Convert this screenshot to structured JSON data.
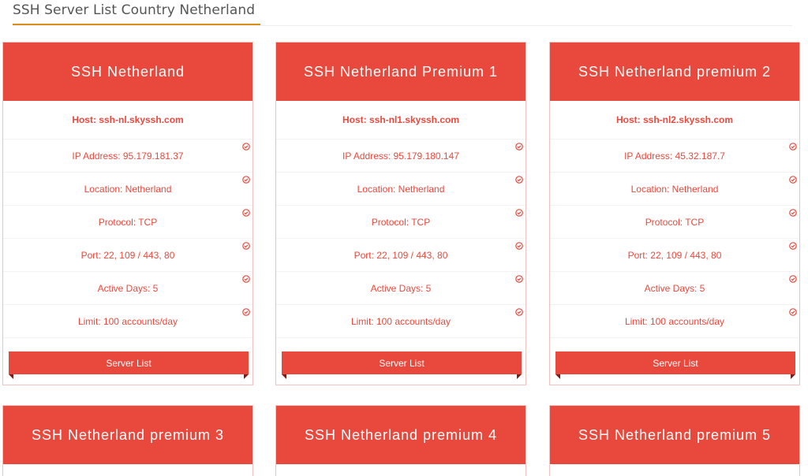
{
  "page": {
    "title": "SSH Server List Country Netherland"
  },
  "colors": {
    "accent": "#e8493c",
    "title_underline": "#d9901b",
    "card_border": "#f0c2c0"
  },
  "icons": {
    "row_status": "check-circle-icon"
  },
  "cards": [
    {
      "title": "SSH Netherland",
      "host": "Host: ssh-nl.skyssh.com",
      "ip": "IP Address: 95.179.181.37",
      "location": "Location: Netherland",
      "protocol": "Protocol: TCP",
      "port": "Port: 22, 109 / 443, 80",
      "active_days": "Active Days: 5",
      "limit": "Limit: 100 accounts/day",
      "button": "Server List"
    },
    {
      "title": "SSH Netherland Premium 1",
      "host": "Host: ssh-nl1.skyssh.com",
      "ip": "IP Address: 95.179.180.147",
      "location": "Location: Netherland",
      "protocol": "Protocol: TCP",
      "port": "Port: 22, 109 / 443, 80",
      "active_days": "Active Days: 5",
      "limit": "Limit: 100 accounts/day",
      "button": "Server List"
    },
    {
      "title": "SSH Netherland premium 2",
      "host": "Host: ssh-nl2.skyssh.com",
      "ip": "IP Address: 45.32.187.7",
      "location": "Location: Netherland",
      "protocol": "Protocol: TCP",
      "port": "Port: 22, 109 / 443, 80",
      "active_days": "Active Days: 5",
      "limit": "Limit: 100 accounts/day",
      "button": "Server List"
    },
    {
      "title": "SSH Netherland premium 3"
    },
    {
      "title": "SSH Netherland premium 4"
    },
    {
      "title": "SSH Netherland premium 5"
    }
  ]
}
